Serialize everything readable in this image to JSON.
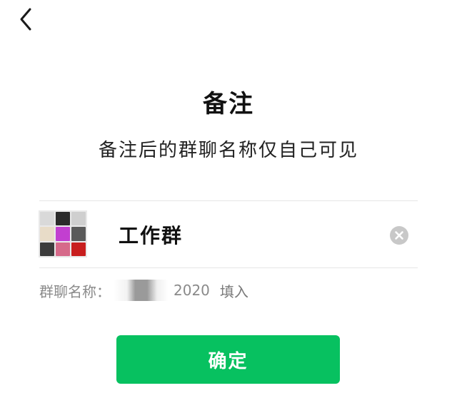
{
  "nav": {
    "back_icon": "chevron-left-icon"
  },
  "header": {
    "title": "备注",
    "subtitle": "备注后的群聊名称仅自己可见"
  },
  "remark_field": {
    "value": "工作群",
    "clear_icon": "clear-circle-icon"
  },
  "group_name": {
    "label": "群聊名称：",
    "number": "2020",
    "fill_label": "填入"
  },
  "actions": {
    "confirm_label": "确定"
  },
  "colors": {
    "accent": "#07c160",
    "avatar_cells": [
      "#d9d9d9",
      "#2b2b2b",
      "#cfcfcf",
      "#e8dcc8",
      "#c23fd0",
      "#5a5a5a",
      "#3c3c3c",
      "#d66a8a",
      "#c81e1e"
    ]
  }
}
